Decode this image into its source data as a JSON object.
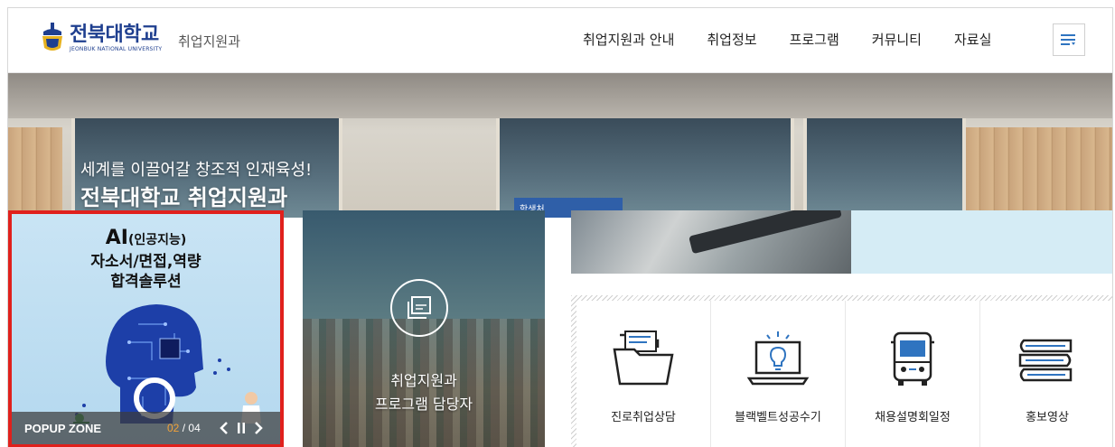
{
  "header": {
    "logo_kr": "전북대학교",
    "logo_en": "JEONBUK NATIONAL UNIVERSITY",
    "dept": "취업지원과",
    "nav": [
      "취업지원과 안내",
      "취업정보",
      "프로그램",
      "커뮤니티",
      "자료실"
    ],
    "menu_icon": "hamburger-menu-icon"
  },
  "hero": {
    "subtitle": "세계를 이끌어갈 창조적 인재육성!",
    "title": "전북대학교 취업지원과",
    "sign": "학생처"
  },
  "popup": {
    "ai": "AI",
    "ai_paren": "(인공지능)",
    "line1": "자소서/면접,역량",
    "line2": "합격솔루션",
    "label": "POPUP ZONE",
    "current": "02",
    "separator": "/",
    "total": "04"
  },
  "program": {
    "line1": "취업지원과",
    "line2": "프로그램 담당자",
    "icon": "window-icon"
  },
  "quick_links": [
    {
      "label": "진로취업상담",
      "icon": "folder-icon"
    },
    {
      "label": "블랙벨트성공수기",
      "icon": "laptop-lightbulb-icon"
    },
    {
      "label": "채용설명회일정",
      "icon": "bus-icon"
    },
    {
      "label": "홍보영상",
      "icon": "books-icon"
    }
  ],
  "colors": {
    "brand_blue": "#1f3f8f",
    "popup_border": "#e0201c",
    "popup_bg": "#c9e4f4",
    "counter_accent": "#f2a23a",
    "icon_blue": "#2f74c0"
  }
}
